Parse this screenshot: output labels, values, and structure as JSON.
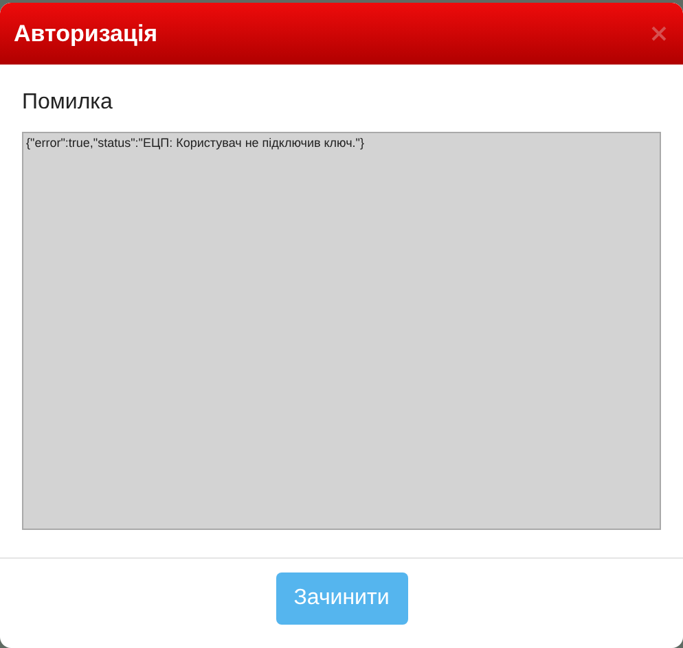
{
  "dialog": {
    "title": "Авторизація",
    "heading": "Помилка",
    "message": "{\"error\":true,\"status\":\"ЕЦП: Користувач не підключив ключ.\"}",
    "buttons": [
      "Зачинити"
    ]
  }
}
